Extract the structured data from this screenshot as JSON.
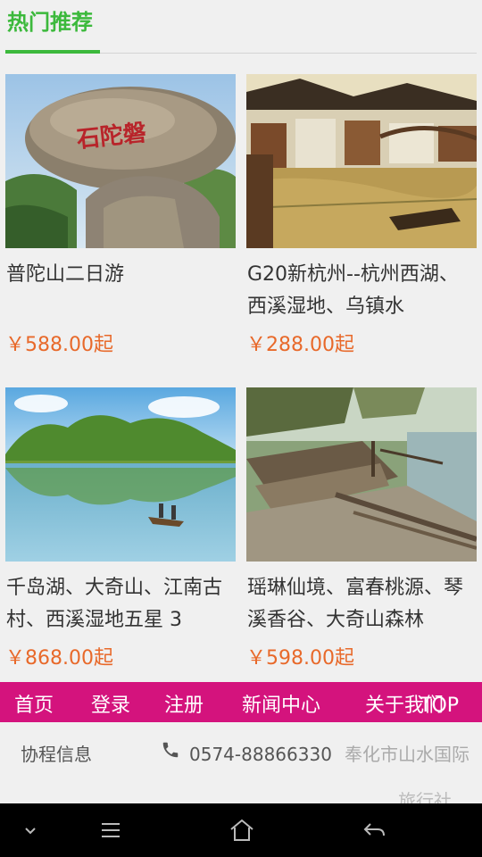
{
  "header": {
    "title": "热门推荐"
  },
  "cards": [
    {
      "title": "普陀山二日游",
      "price": "￥588.00起",
      "photo": "putuo-rock-photo"
    },
    {
      "title": "G20新杭州--杭州西湖、西溪湿地、乌镇水",
      "price": "￥288.00起",
      "photo": "water-town-photo"
    },
    {
      "title": "千岛湖、大奇山、江南古村、西溪湿地五星 3",
      "price": "￥868.00起",
      "photo": "lake-boat-photo"
    },
    {
      "title": "瑶琳仙境、富春桃源、琴溪香谷、大奇山森林",
      "price": "￥598.00起",
      "photo": "waterside-village-photo"
    }
  ],
  "nav": {
    "background": "#d4137d",
    "items": [
      "首页",
      "登录",
      "注册",
      "新闻中心",
      "关于我们"
    ],
    "top_label": "TOP"
  },
  "footer": {
    "brand": "协程信息",
    "phone": "0574-88866330",
    "company_line1": "奉化市山水国际",
    "company_line2": "旅行社"
  },
  "system_bar": {
    "buttons": [
      "chevron-down-icon",
      "menu-icon",
      "home-icon",
      "back-icon"
    ]
  },
  "colors": {
    "accent_green": "#3cb93c",
    "price_orange": "#e8692a"
  }
}
